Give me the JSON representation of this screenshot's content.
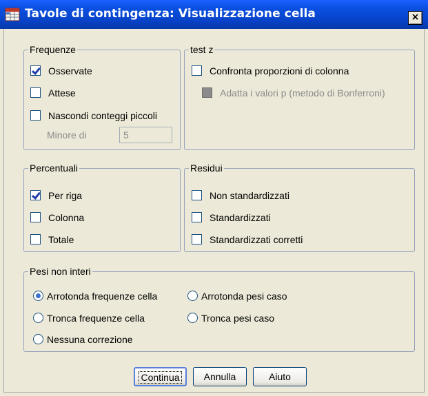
{
  "window": {
    "title": "Tavole di contingenza: Visualizzazione cella",
    "close_label": "×",
    "app_icon": "spss-table-icon"
  },
  "frequenze": {
    "legend": "Frequenze",
    "items": [
      {
        "label": "Osservate",
        "checked": true
      },
      {
        "label": "Attese",
        "checked": false
      },
      {
        "label": "Nascondi conteggi piccoli",
        "checked": false
      }
    ],
    "minore_label": "Minore di",
    "minore_value": "5"
  },
  "test_z": {
    "legend": "test z",
    "items": [
      {
        "label": "Confronta proporzioni di colonna",
        "checked": false
      },
      {
        "label": "Adatta i valori p (metodo di Bonferroni)",
        "checked": false,
        "disabled": true
      }
    ]
  },
  "percentuali": {
    "legend": "Percentuali",
    "items": [
      {
        "label": "Per riga",
        "checked": true
      },
      {
        "label": "Colonna",
        "checked": false
      },
      {
        "label": "Totale",
        "checked": false
      }
    ]
  },
  "residui": {
    "legend": "Residui",
    "items": [
      {
        "label": "Non standardizzati",
        "checked": false
      },
      {
        "label": "Standardizzati",
        "checked": false
      },
      {
        "label": "Standardizzati corretti",
        "checked": false
      }
    ]
  },
  "pesi": {
    "legend": "Pesi non interi",
    "options": [
      {
        "label": "Arrotonda frequenze cella",
        "selected": true
      },
      {
        "label": "Arrotonda pesi caso",
        "selected": false
      },
      {
        "label": "Tronca frequenze cella",
        "selected": false
      },
      {
        "label": "Tronca pesi caso",
        "selected": false
      },
      {
        "label": "Nessuna correzione",
        "selected": false
      }
    ]
  },
  "buttons": {
    "continua": "Continua",
    "annulla": "Annulla",
    "aiuto": "Aiuto"
  }
}
